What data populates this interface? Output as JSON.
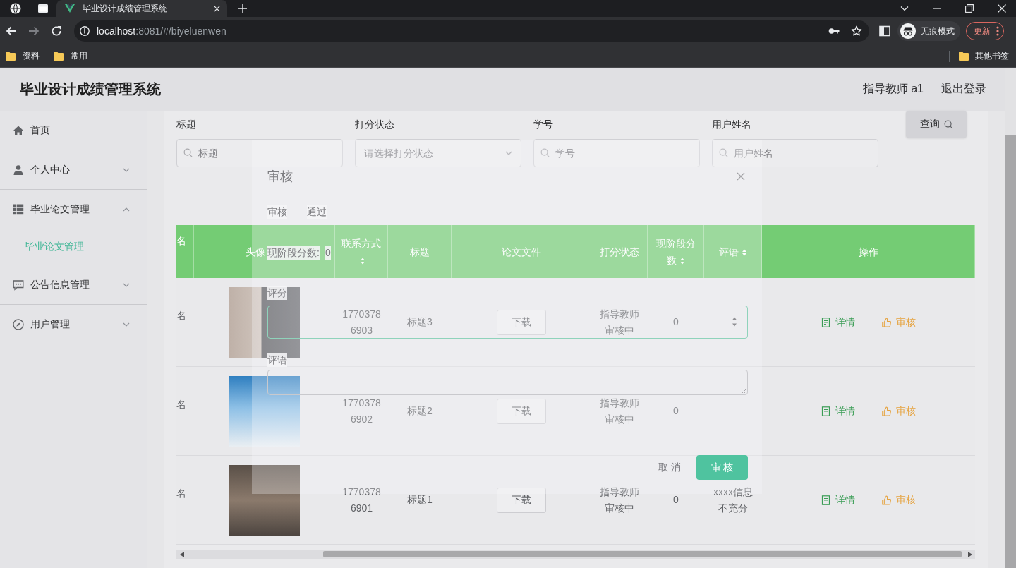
{
  "browser": {
    "tabs": [
      {
        "title": "毕业设计成绩管理系统",
        "selected": true
      }
    ],
    "address": {
      "host": "localhost",
      "path": ":8081/#/biyeluenwen"
    },
    "profile": "无痕模式",
    "update_button": "更新",
    "bookmarks": [
      {
        "label": "资料"
      },
      {
        "label": "常用"
      }
    ],
    "other_bookmarks": "其他书签"
  },
  "header": {
    "title": "毕业设计成绩管理系统",
    "user": "指导教师 a1",
    "logout": "退出登录"
  },
  "sidebar": {
    "items": [
      {
        "label": "首页",
        "kind": "home",
        "selected": false
      },
      {
        "label": "个人中心",
        "kind": "user",
        "selected": false,
        "expanded": false
      },
      {
        "label": "毕业论文管理",
        "kind": "grid",
        "selected": false,
        "expanded": true,
        "children": [
          {
            "label": "毕业论文管理",
            "selected": true
          }
        ]
      },
      {
        "label": "公告信息管理",
        "kind": "chat",
        "selected": false,
        "expanded": false
      },
      {
        "label": "用户管理",
        "kind": "compass",
        "selected": false,
        "expanded": false
      }
    ]
  },
  "search": {
    "fields": [
      {
        "kind": "input",
        "label": "标题",
        "placeholder": "标题"
      },
      {
        "kind": "select",
        "label": "打分状态",
        "placeholder": "请选择打分状态"
      },
      {
        "kind": "input",
        "label": "学号",
        "placeholder": "学号"
      },
      {
        "kind": "input",
        "label": "用户姓名",
        "placeholder": "用户姓名"
      }
    ],
    "button": "查询"
  },
  "table": {
    "columns": [
      {
        "label": "名",
        "sortable": false
      },
      {
        "label": "头像",
        "sortable": false
      },
      {
        "label": "联系方式",
        "sortable": true
      },
      {
        "label": "标题",
        "sortable": false
      },
      {
        "label": "论文文件",
        "sortable": false
      },
      {
        "label": "打分状态",
        "sortable": false
      },
      {
        "label": "现阶段分数",
        "sortable": true
      },
      {
        "label": "评语",
        "sortable": true
      },
      {
        "label": "操作",
        "sortable": false
      }
    ],
    "rows": [
      {
        "name": "名",
        "phone": "17703786903",
        "title": "标题3",
        "file_button": "下载",
        "status": "指导教师审核中",
        "score": "0",
        "actions": [
          {
            "kind": "detail",
            "label": "详情"
          },
          {
            "kind": "review",
            "label": "审核"
          }
        ]
      },
      {
        "name": "名",
        "phone": "17703786902",
        "title": "标题2",
        "file_button": "下载",
        "status": "指导教师审核中",
        "score": "0",
        "actions": [
          {
            "kind": "detail",
            "label": "详情"
          },
          {
            "kind": "review",
            "label": "审核"
          }
        ]
      },
      {
        "name": "名",
        "phone": "17703786901",
        "title": "标题1",
        "file_button": "下载",
        "status": "指导教师审核中",
        "score": "0",
        "comment": "xxxx信息不充分",
        "actions": [
          {
            "kind": "detail",
            "label": "详情"
          },
          {
            "kind": "review",
            "label": "审核"
          }
        ]
      }
    ]
  },
  "dialog": {
    "title": "审核",
    "fields": [
      {
        "kind": "text",
        "label": "审核",
        "value": "通过"
      },
      {
        "kind": "text",
        "label": "现阶段分数:",
        "value": "0"
      },
      {
        "kind": "number",
        "label": "评分"
      },
      {
        "kind": "textarea",
        "label": "评语"
      }
    ],
    "buttons": [
      {
        "kind": "plain",
        "label": "取 消"
      },
      {
        "kind": "primary",
        "label": "审 核"
      }
    ]
  }
}
